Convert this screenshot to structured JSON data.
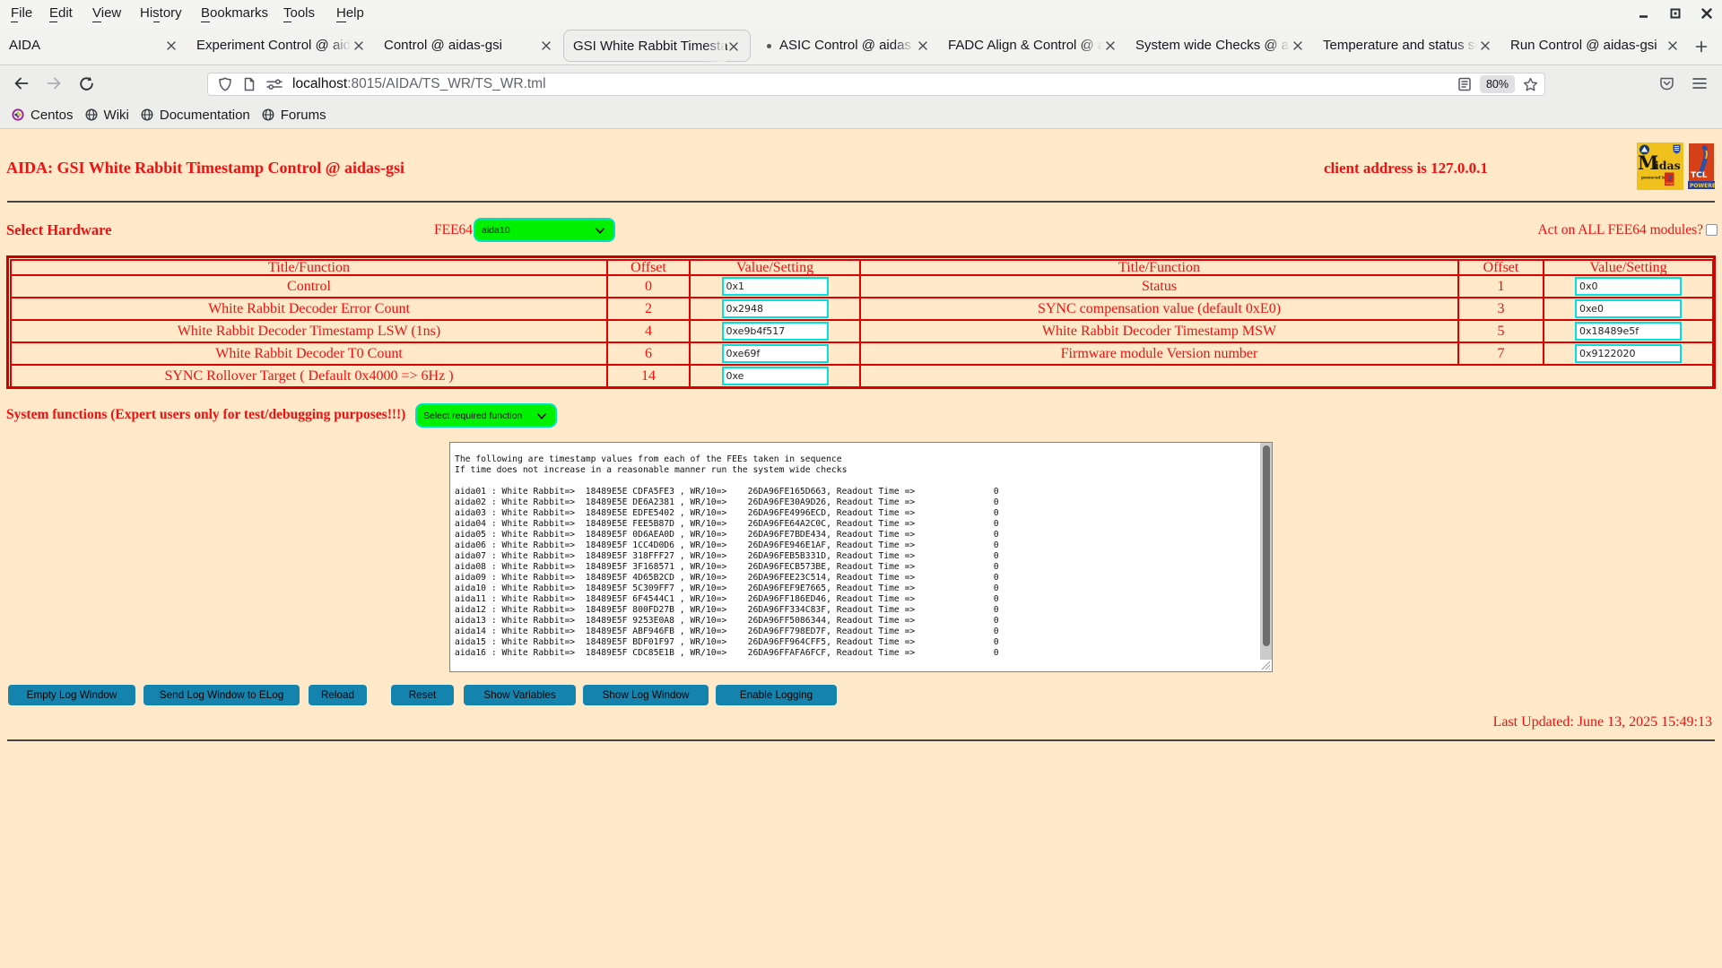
{
  "browser": {
    "menus": [
      {
        "label": "File"
      },
      {
        "label": "Edit"
      },
      {
        "label": "View"
      },
      {
        "label": "History"
      },
      {
        "label": "Bookmarks"
      },
      {
        "label": "Tools"
      },
      {
        "label": "Help"
      }
    ],
    "tabs": [
      {
        "label": "AIDA",
        "active": false,
        "dot": false
      },
      {
        "label": "Experiment Control @ aida",
        "active": false,
        "dot": false
      },
      {
        "label": "Control @ aidas-gsi",
        "active": false,
        "dot": false
      },
      {
        "label": "GSI White Rabbit Timestam",
        "active": true,
        "dot": false
      },
      {
        "label": "ASIC Control @ aidas-g",
        "active": false,
        "dot": true
      },
      {
        "label": "FADC Align & Control @ ai",
        "active": false,
        "dot": false
      },
      {
        "label": "System wide Checks @ aid",
        "active": false,
        "dot": false
      },
      {
        "label": "Temperature and status sc",
        "active": false,
        "dot": false
      },
      {
        "label": "Run Control @ aidas-gsi",
        "active": false,
        "dot": false
      }
    ],
    "url": {
      "host": "localhost",
      "path": ":8015/AIDA/TS_WR/TS_WR.tml"
    },
    "zoom_level": "80%",
    "bookmarks": [
      {
        "label": "Centos"
      },
      {
        "label": "Wiki"
      },
      {
        "label": "Documentation"
      },
      {
        "label": "Forums"
      }
    ]
  },
  "page": {
    "title": "AIDA: GSI White Rabbit Timestamp Control @ aidas-gsi",
    "client_address": "client address is 127.0.0.1",
    "select_hardware_label": "Select Hardware",
    "fee64_label": "FEE64",
    "fee64_value": "aida10",
    "act_on_all_label": "Act on ALL FEE64 modules?",
    "system_functions_label": "System functions (Expert users only for test/debugging purposes!!!)",
    "system_functions_value": "Select required function",
    "table": {
      "headers": [
        "Title/Function",
        "Offset",
        "Value/Setting",
        "Title/Function",
        "Offset",
        "Value/Setting"
      ],
      "rows": [
        {
          "left": {
            "title": "Control",
            "offset": "0",
            "value": "0x1"
          },
          "right": {
            "title": "Status",
            "offset": "1",
            "value": "0x0"
          }
        },
        {
          "left": {
            "title": "White Rabbit Decoder Error Count",
            "offset": "2",
            "value": "0x2948"
          },
          "right": {
            "title": "SYNC compensation value (default 0xE0)",
            "offset": "3",
            "value": "0xe0"
          }
        },
        {
          "left": {
            "title": "White Rabbit Decoder Timestamp LSW (1ns)",
            "offset": "4",
            "value": "0xe9b4f517"
          },
          "right": {
            "title": "White Rabbit Decoder Timestamp MSW",
            "offset": "5",
            "value": "0x18489e5f"
          }
        },
        {
          "left": {
            "title": "White Rabbit Decoder T0 Count",
            "offset": "6",
            "value": "0xe69f"
          },
          "right": {
            "title": "Firmware module Version number",
            "offset": "7",
            "value": "0x9122020"
          }
        },
        {
          "left": {
            "title": "SYNC Rollover Target ( Default 0x4000 => 6Hz )",
            "offset": "14",
            "value": "0xe"
          },
          "right": {
            "title": "",
            "offset": "",
            "value": ""
          }
        }
      ]
    },
    "log_text": "The following are timestamp values from each of the FEEs taken in sequence\nIf time does not increase in a reasonable manner run the system wide checks\n\naida01 : White Rabbit=>  18489E5E CDFA5FE3 , WR/10=>    26DA96FE165D663, Readout Time =>               0\naida02 : White Rabbit=>  18489E5E DE6A2381 , WR/10=>    26DA96FE30A9D26, Readout Time =>               0\naida03 : White Rabbit=>  18489E5E EDFE5402 , WR/10=>    26DA96FE4996ECD, Readout Time =>               0\naida04 : White Rabbit=>  18489E5E FEE5B87D , WR/10=>    26DA96FE64A2C0C, Readout Time =>               0\naida05 : White Rabbit=>  18489E5F 0D6AEA0D , WR/10=>    26DA96FE7BDE434, Readout Time =>               0\naida06 : White Rabbit=>  18489E5F 1CC4D0D6 , WR/10=>    26DA96FE946E1AF, Readout Time =>               0\naida07 : White Rabbit=>  18489E5F 318FFF27 , WR/10=>    26DA96FEB5B331D, Readout Time =>               0\naida08 : White Rabbit=>  18489E5F 3F168571 , WR/10=>    26DA96FECB573BE, Readout Time =>               0\naida09 : White Rabbit=>  18489E5F 4D65B2CD , WR/10=>    26DA96FEE23C514, Readout Time =>               0\naida10 : White Rabbit=>  18489E5F 5C309FF7 , WR/10=>    26DA96FEF9E7665, Readout Time =>               0\naida11 : White Rabbit=>  18489E5F 6F4544C1 , WR/10=>    26DA96FF186ED46, Readout Time =>               0\naida12 : White Rabbit=>  18489E5F 800FD27B , WR/10=>    26DA96FF334C83F, Readout Time =>               0\naida13 : White Rabbit=>  18489E5F 9253E0A8 , WR/10=>    26DA96FF5086344, Readout Time =>               0\naida14 : White Rabbit=>  18489E5F ABF946FB , WR/10=>    26DA96FF798ED7F, Readout Time =>               0\naida15 : White Rabbit=>  18489E5F BDF01F97 , WR/10=>    26DA96FF964CFF5, Readout Time =>               0\naida16 : White Rabbit=>  18489E5F CDC85E1B , WR/10=>    26DA96FFAFA6FCF, Readout Time =>               0",
    "buttons": [
      "Empty Log Window",
      "Send Log Window to ELog",
      "Reload",
      "Reset",
      "Show Variables",
      "Show Log Window",
      "Enable Logging"
    ],
    "last_updated": "Last Updated: June 13, 2025 15:49:13",
    "logos": {
      "midas_text": "Midas",
      "midas_sub": "powered by",
      "tcl_text": "TCL",
      "tcl_sub": "POWERED"
    }
  },
  "colors": {
    "page_background": "#ffe9c9",
    "red_text": "#ef1111",
    "table_border": "#cc0000",
    "input_border": "#00e0e0",
    "select_green": "#00f000",
    "button_blue": "#1484ae"
  }
}
